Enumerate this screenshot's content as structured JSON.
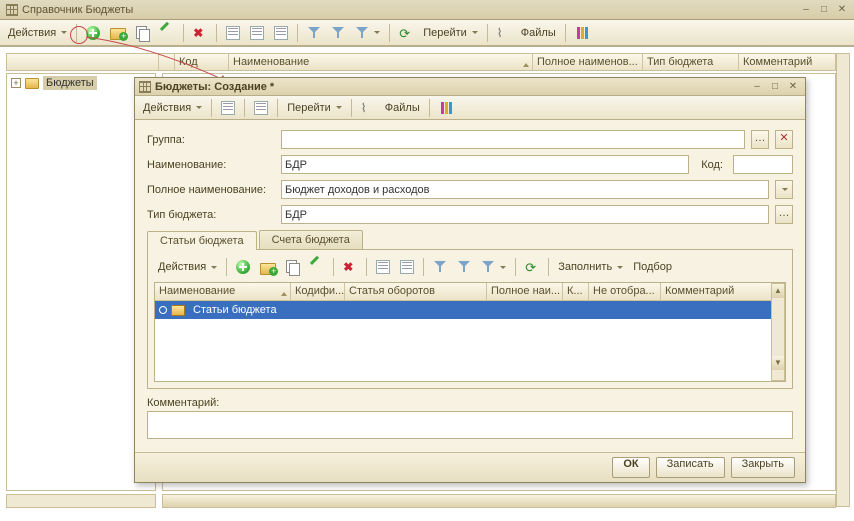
{
  "main_window": {
    "title": "Справочник Бюджеты",
    "toolbar": {
      "actions_label": "Действия",
      "go_label": "Перейти",
      "files_label": "Файлы"
    },
    "columns": {
      "code": "Код",
      "name": "Наименование",
      "full_name": "Полное наименов...",
      "budget_type": "Тип бюджета",
      "comment": "Комментарий"
    },
    "tree": {
      "root_label": "Бюджеты"
    }
  },
  "dialog": {
    "title": "Бюджеты: Создание *",
    "toolbar": {
      "actions_label": "Действия",
      "go_label": "Перейти",
      "files_label": "Файлы"
    },
    "form": {
      "group_label": "Группа:",
      "group_value": "",
      "name_label": "Наименование:",
      "name_value": "БДР",
      "code_label": "Код:",
      "code_value": "",
      "full_name_label": "Полное наименование:",
      "full_name_value": "Бюджет доходов и расходов",
      "type_label": "Тип бюджета:",
      "type_value": "БДР"
    },
    "tabs": {
      "tab1": "Статьи бюджета",
      "tab2": "Счета бюджета"
    },
    "inner_toolbar": {
      "actions_label": "Действия",
      "fill_label": "Заполнить",
      "pick_label": "Подбор"
    },
    "inner_columns": {
      "name": "Наименование",
      "codifier": "Кодифи...",
      "turnover": "Статья оборотов",
      "full": "Полное наи...",
      "k": "К...",
      "noshow": "Не отобра...",
      "comment": "Комментарий"
    },
    "inner_row": {
      "name": "Статьи бюджета"
    },
    "comment_label": "Комментарий:",
    "footer": {
      "ok": "ОК",
      "save": "Записать",
      "close": "Закрыть"
    }
  }
}
